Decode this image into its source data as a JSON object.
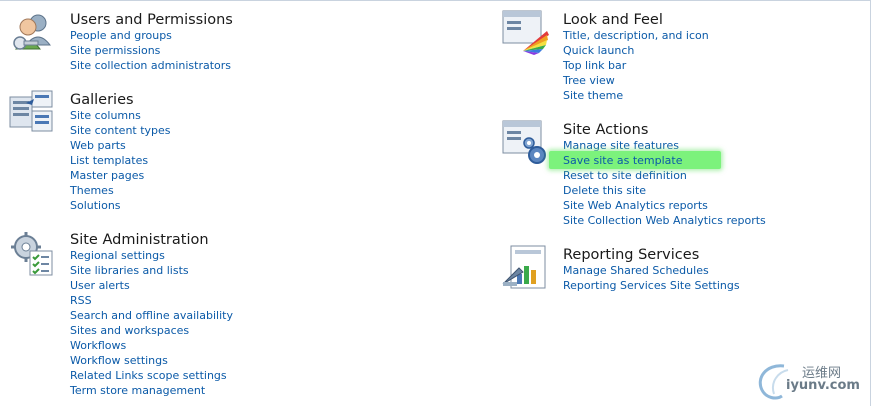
{
  "sections": {
    "users": {
      "title": "Users and Permissions",
      "icon": "users-permissions-icon",
      "links": [
        "People and groups",
        "Site permissions",
        "Site collection administrators"
      ]
    },
    "galleries": {
      "title": "Galleries",
      "icon": "galleries-icon",
      "links": [
        "Site columns",
        "Site content types",
        "Web parts",
        "List templates",
        "Master pages",
        "Themes",
        "Solutions"
      ]
    },
    "site_admin": {
      "title": "Site Administration",
      "icon": "site-administration-icon",
      "links": [
        "Regional settings",
        "Site libraries and lists",
        "User alerts",
        "RSS",
        "Search and offline availability",
        "Sites and workspaces",
        "Workflows",
        "Workflow settings",
        "Related Links scope settings",
        "Term store management"
      ]
    },
    "look_feel": {
      "title": "Look and Feel",
      "icon": "look-and-feel-icon",
      "links": [
        "Title, description, and icon",
        "Quick launch",
        "Top link bar",
        "Tree view",
        "Site theme"
      ]
    },
    "site_actions": {
      "title": "Site Actions",
      "icon": "site-actions-icon",
      "links": [
        "Manage site features",
        "Save site as template",
        "Reset to site definition",
        "Delete this site",
        "Site Web Analytics reports",
        "Site Collection Web Analytics reports"
      ],
      "highlighted_link": "Save site as template"
    },
    "reporting": {
      "title": "Reporting Services",
      "icon": "reporting-services-icon",
      "links": [
        "Manage Shared Schedules",
        "Reporting Services Site Settings"
      ]
    }
  },
  "colors": {
    "link": "#0b5aa8",
    "title": "#1a1a1a",
    "highlight": "#7cf27c"
  },
  "watermark": {
    "text_cn": "运维网",
    "text_en": "iyunv.com"
  }
}
